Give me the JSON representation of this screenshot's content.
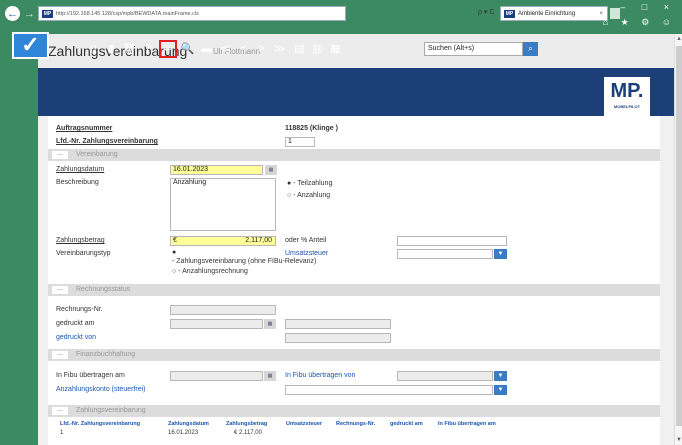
{
  "browser": {
    "address": "http://192.168.145.128/csp/mpb/BEWDATA.mainFrame.cls",
    "addr_tools": "ρ ▾ C",
    "tab_title": "Ambiente Einrichtung",
    "mp_badge": "MP",
    "close": "×",
    "window_controls": "–  □  ×",
    "chrome_icons": "⌂ ★ ⚙ ☺"
  },
  "app": {
    "title": "Zahlungsvereinbarung",
    "user": "Uli Flottmann",
    "search_placeholder": "Suchen (Alt+s)",
    "logo": "MP.",
    "logo_sub": "MOBELPILOT"
  },
  "toolbar": {
    "icons": [
      {
        "name": "new-doc-icon",
        "glyph": "▯"
      },
      {
        "name": "bookmark-icon",
        "glyph": "▮"
      },
      {
        "name": "trash-icon",
        "glyph": "🗑"
      },
      {
        "name": "help-icon",
        "glyph": "?"
      },
      {
        "name": "back-arrow-icon",
        "glyph": "⇐"
      },
      {
        "name": "search-zoom-icon",
        "glyph": "🔍"
      },
      {
        "name": "print-icon",
        "glyph": "▬"
      },
      {
        "name": "first-icon",
        "glyph": "≪"
      },
      {
        "name": "prev-icon",
        "glyph": "<"
      },
      {
        "name": "next-icon",
        "glyph": ">"
      },
      {
        "name": "last-icon",
        "glyph": "≫"
      },
      {
        "name": "copy-icon",
        "glyph": "▤"
      },
      {
        "name": "doc-edit-icon",
        "glyph": "▥"
      },
      {
        "name": "image-icon",
        "glyph": "▦"
      }
    ],
    "check": "✓"
  },
  "form": {
    "auftragsnummer_label": "Auftragsnummer",
    "auftragsnummer_value": "118825 (Klinge )",
    "lfd_label": "Lfd.-Nr. Zahlungsvereinbarung",
    "lfd_value": "1",
    "sections": {
      "vereinbarung": "Vereinbarung",
      "rechnungsstatus": "Rechnungsstatus",
      "finanz": "Finanzbuchhaltung",
      "zahlungs": "Zahlungsvereinbarung"
    },
    "toggle": "—",
    "zahlungsdatum_label": "Zahlungsdatum",
    "zahlungsdatum_value": "16.01.2023",
    "beschreibung_label": "Beschreibung",
    "beschreibung_value": "Anzahlung",
    "teilzahlung": "● - Teilzahlung",
    "anzahlung": "○ - Anzahlung",
    "zahlungsbetrag_label": "Zahlungsbetrag",
    "currency": "€",
    "zahlungsbetrag_value": "2.117,00",
    "oder_anteil": "oder % Anteil",
    "vereinbarungstyp_label": "Vereinbarungstyp",
    "typ_option1": "- Zahlungsvereinbarung (ohne FIBu-Relevanz)",
    "typ_option2": "○ - Anzahlungsrechnung",
    "radio_on": "●",
    "umsatzsteuer": "Umsatzsteuer",
    "rechnungsnr_label": "Rechnungs-Nr.",
    "gedruckt_am_label": "gedruckt am",
    "gedruckt_von_label": "gedruckt von",
    "fibu_am_label": "In Fibu übertragen am",
    "fibu_von_label": "In Fibu übertragen von",
    "anzahlungskonto_label": "Anzahlungskonto (steuerfrei)",
    "cal_glyph": "▦",
    "dd_glyph": "▼"
  },
  "table": {
    "headers": [
      "Lfd.-Nr. Zahlungsvereinbarung",
      "Zahlungsdatum",
      "Zahlungsbetrag",
      "Umsatzsteuer",
      "Rechnungs-Nr.",
      "gedruckt am",
      "In Fibu übertragen am"
    ],
    "rows": [
      [
        "1",
        "16.01.2023",
        "€ 2.117,00",
        "",
        "",
        "",
        ""
      ]
    ]
  },
  "scroll": {
    "up": "▲",
    "down": "▼"
  }
}
